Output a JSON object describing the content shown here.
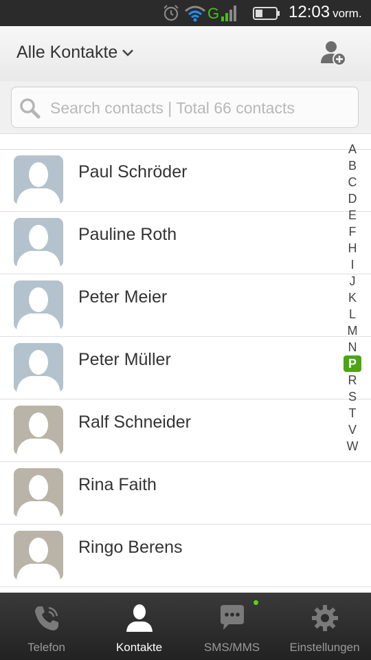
{
  "status_bar": {
    "network_label": "G",
    "time": "12:03",
    "ampm": "vorm."
  },
  "header": {
    "title": "Alle Kontakte",
    "add_icon": "add-contact-icon"
  },
  "search": {
    "placeholder": "Search contacts | Total 66 contacts"
  },
  "contacts": [
    {
      "name": "Paul Schröder",
      "avatar_color": "#b3c2cc"
    },
    {
      "name": "Pauline Roth",
      "avatar_color": "#b3c2cc"
    },
    {
      "name": "Peter Meier",
      "avatar_color": "#b3c2cc"
    },
    {
      "name": "Peter Müller",
      "avatar_color": "#b3c2cc"
    },
    {
      "name": "Ralf Schneider",
      "avatar_color": "#b9b4a7"
    },
    {
      "name": "Rina Faith",
      "avatar_color": "#b9b4a7"
    },
    {
      "name": "Ringo Berens",
      "avatar_color": "#b9b4a7"
    }
  ],
  "alphabet": [
    "A",
    "B",
    "C",
    "D",
    "E",
    "F",
    "H",
    "I",
    "J",
    "K",
    "L",
    "M",
    "N",
    "P",
    "R",
    "S",
    "T",
    "V",
    "W"
  ],
  "alphabet_active": "P",
  "nav": {
    "items": [
      {
        "label": "Telefon",
        "icon": "phone-icon"
      },
      {
        "label": "Kontakte",
        "icon": "contacts-icon"
      },
      {
        "label": "SMS/MMS",
        "icon": "message-icon"
      },
      {
        "label": "Einstellungen",
        "icon": "gear-icon"
      }
    ],
    "active": "Kontakte"
  },
  "colors": {
    "accent_green": "#4ca514",
    "nav_bg": "#2b2b2b"
  }
}
